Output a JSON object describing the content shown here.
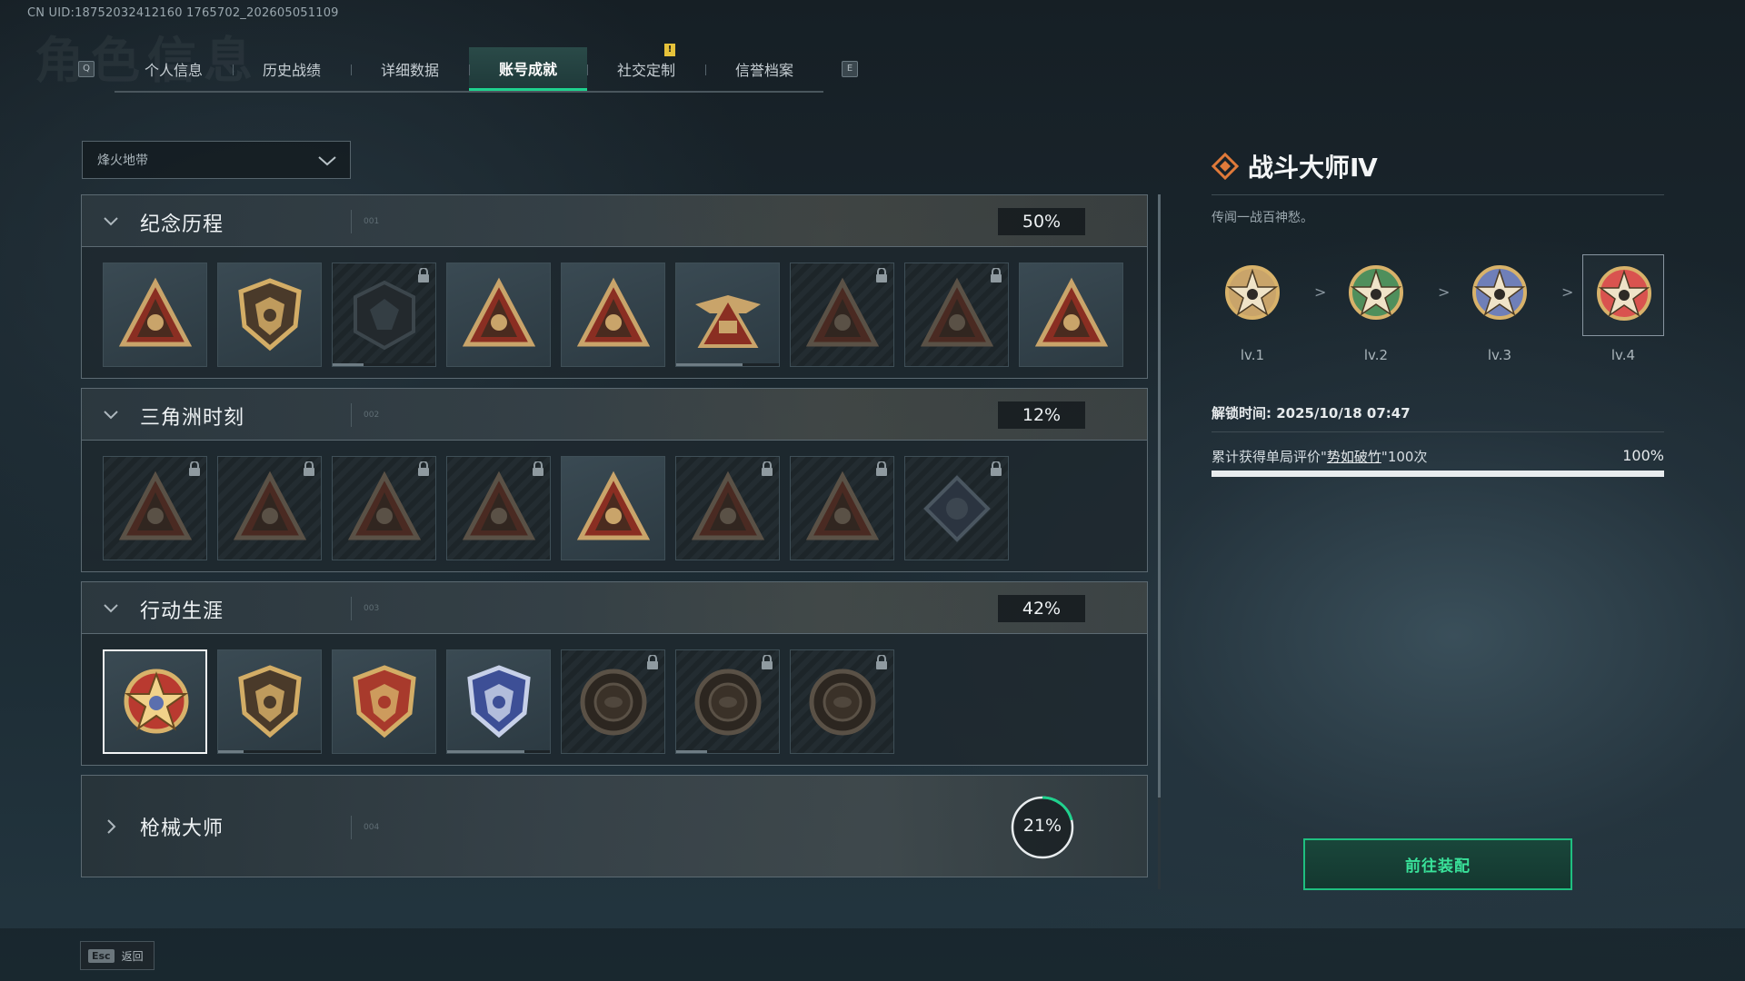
{
  "uid": "CN UID:18752032412160 1765702_202605051109",
  "ghost_title": "角色信息",
  "tabs": {
    "left_key": "Q",
    "right_key": "E",
    "items": [
      {
        "label": "个人信息"
      },
      {
        "label": "历史战绩"
      },
      {
        "label": "详细数据"
      },
      {
        "label": "账号成就",
        "active": true
      },
      {
        "label": "社交定制",
        "badge": "!"
      },
      {
        "label": "信誉档案"
      }
    ]
  },
  "dropdown": {
    "value": "烽火地带"
  },
  "sections": [
    {
      "title": "纪念历程",
      "num": "001",
      "percent": "50%",
      "tiles": [
        {
          "icon": "delta-triangle-shield-icon",
          "locked": false
        },
        {
          "icon": "helicopter-shield-icon",
          "locked": false
        },
        {
          "icon": "hex-emblem-icon",
          "locked": true,
          "progress": 0.3
        },
        {
          "icon": "season-s7-triangle-icon",
          "locked": false
        },
        {
          "icon": "season-s8-triangle-icon",
          "locked": false
        },
        {
          "icon": "season-s9-winged-icon",
          "locked": false,
          "progress": 0.65
        },
        {
          "icon": "masked-operator-triangle-icon",
          "locked": true
        },
        {
          "icon": "skull-crossed-rifles-icon",
          "locked": true
        },
        {
          "icon": "number-one-triangle-icon",
          "locked": false
        }
      ]
    },
    {
      "title": "三角洲时刻",
      "num": "002",
      "percent": "12%",
      "tiles": [
        {
          "icon": "bottle-triangle-icon",
          "locked": true
        },
        {
          "icon": "pack-triangle-icon",
          "locked": true
        },
        {
          "icon": "seated-figure-triangle-icon",
          "locked": true
        },
        {
          "icon": "target-triangle-icon",
          "locked": true
        },
        {
          "icon": "soldiers-triangle-icon",
          "locked": false
        },
        {
          "icon": "group-triangle-icon",
          "locked": true
        },
        {
          "icon": "leaping-triangle-icon",
          "locked": true
        },
        {
          "icon": "diamond-flower-icon",
          "locked": true
        }
      ]
    },
    {
      "title": "行动生涯",
      "num": "003",
      "percent": "42%",
      "tiles": [
        {
          "icon": "star-medal-icon",
          "locked": false,
          "selected": true
        },
        {
          "icon": "shield-medal-bronze-icon",
          "locked": false,
          "progress": 0.25
        },
        {
          "icon": "shield-medal-gold-icon",
          "locked": false
        },
        {
          "icon": "shield-medal-blue-icon",
          "locked": false,
          "progress": 0.75
        },
        {
          "icon": "round-medal-icon",
          "locked": true
        },
        {
          "icon": "crosshair-medal-icon",
          "locked": true,
          "progress": 0.3
        },
        {
          "icon": "eye-medal-icon",
          "locked": true
        }
      ]
    },
    {
      "title": "枪械大师",
      "num": "004",
      "percent": "21%",
      "collapsed": true,
      "ring_fraction": 0.21
    }
  ],
  "detail": {
    "title": "战斗大师Ⅳ",
    "description": "传闻一战百神愁。",
    "levels": [
      {
        "label": "lv.1",
        "color": "#c9a46a"
      },
      {
        "label": "lv.2",
        "color": "#4f8f5c"
      },
      {
        "label": "lv.3",
        "color": "#6f7fb8"
      },
      {
        "label": "lv.4",
        "color": "#d9534f"
      }
    ],
    "level_arrow": ">",
    "unlock_time": "解锁时间: 2025/10/18 07:47",
    "condition_prefix": "累计获得单局评价\"",
    "condition_link": "势如破竹",
    "condition_suffix": "\"100次",
    "condition_percent": "100%",
    "condition_progress": 1.0
  },
  "equip_button": "前往装配",
  "footer": {
    "esc_key": "Esc",
    "back_label": "返回"
  },
  "colors": {
    "accent": "#1fd28e",
    "gold": "#c9a46a",
    "lock": "#8f9aa0"
  }
}
